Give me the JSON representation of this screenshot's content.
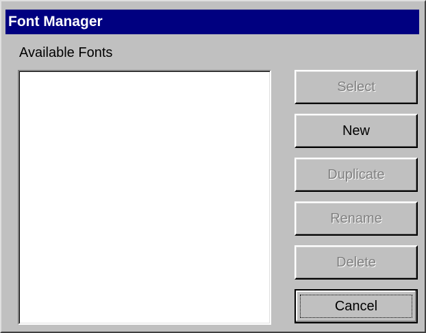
{
  "window": {
    "title": "Font Manager"
  },
  "fonts": {
    "label": "Available Fonts",
    "items": []
  },
  "buttons": {
    "select": "Select",
    "new": "New",
    "duplicate": "Duplicate",
    "rename": "Rename",
    "delete": "Delete",
    "cancel": "Cancel"
  },
  "colors": {
    "titlebar": "#000080",
    "face": "#c0c0c0",
    "disabled_text": "#808080"
  }
}
